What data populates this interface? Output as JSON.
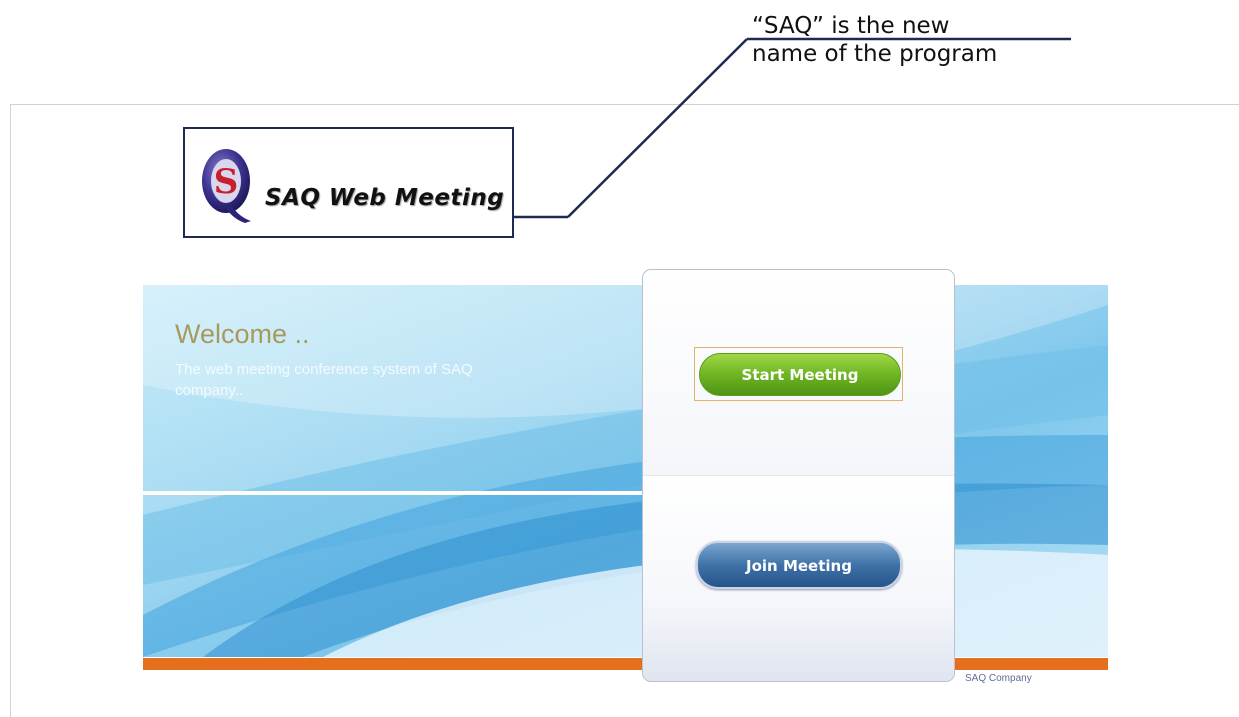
{
  "annotation": {
    "line1": "“SAQ” is the new",
    "line2": "name of the program"
  },
  "logo": {
    "letter": "S",
    "text": "SAQ Web Meeting"
  },
  "banner": {
    "title": "Welcome ..",
    "subtitle": "The web meeting conference system of SAQ company..",
    "footer": "SAQ Company"
  },
  "actions": {
    "start_label": "Start Meeting",
    "join_label": "Join Meeting"
  },
  "colors": {
    "accent_orange": "#e56f1c",
    "start_green": "#6fb523",
    "join_blue": "#3f72a8",
    "annotation_navy": "#1d2b53"
  }
}
